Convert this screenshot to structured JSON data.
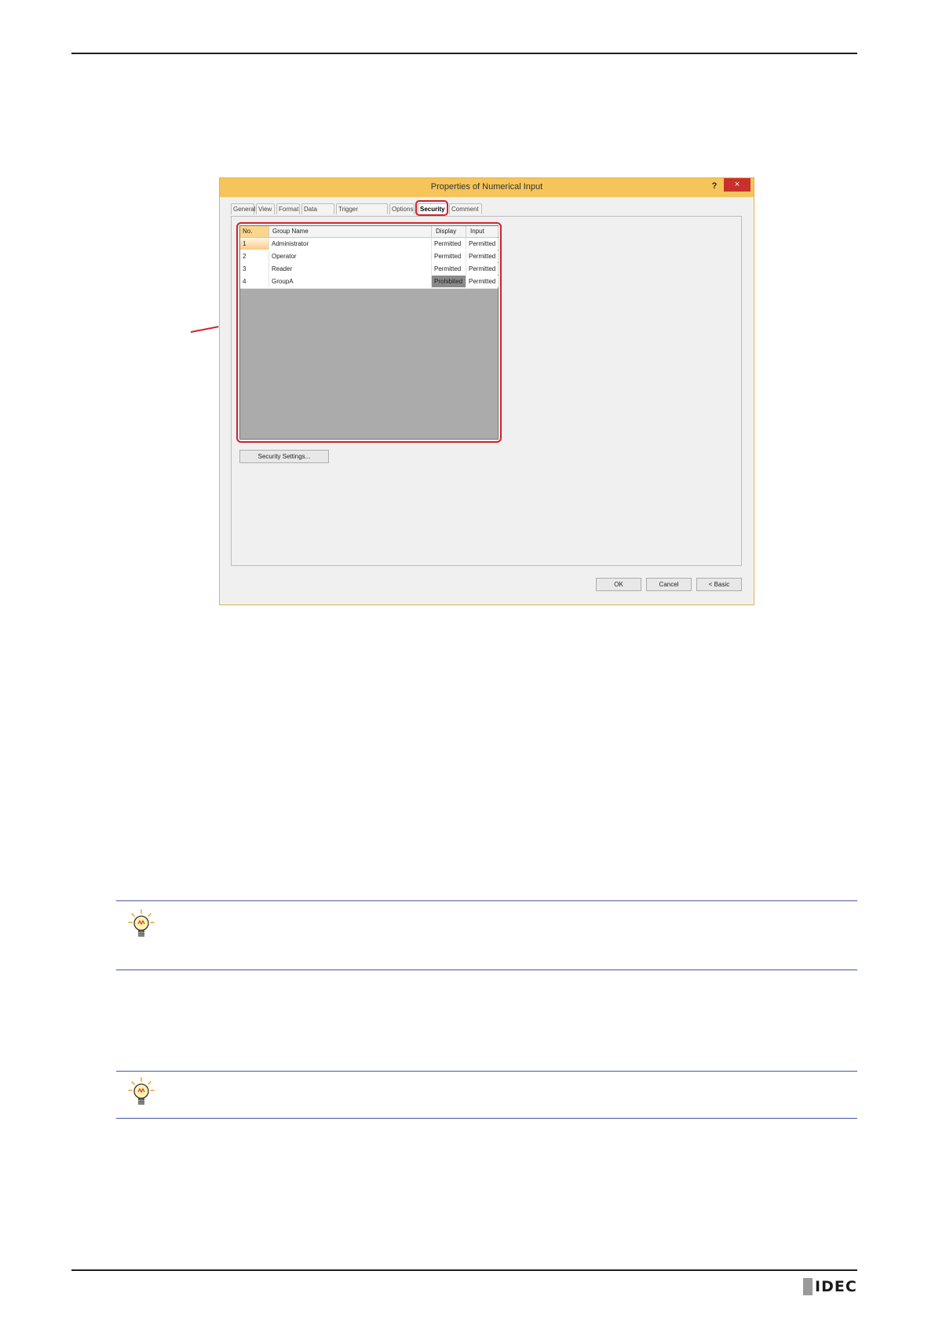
{
  "dialog": {
    "title": "Properties of Numerical Input",
    "help_label": "?",
    "close_label": "×",
    "tabs": [
      {
        "label": "General"
      },
      {
        "label": "View"
      },
      {
        "label": "Format"
      },
      {
        "label": "Data Over"
      },
      {
        "label": "Trigger Condition"
      },
      {
        "label": "Options"
      },
      {
        "label": "Security"
      },
      {
        "label": "Comment"
      }
    ],
    "active_tab": "Security",
    "grid": {
      "columns": [
        "No.",
        "Group Name",
        "Display",
        "Input"
      ],
      "rows": [
        {
          "no": "1",
          "group": "Administrator",
          "display": "Permitted",
          "input": "Permitted"
        },
        {
          "no": "2",
          "group": "Operator",
          "display": "Permitted",
          "input": "Permitted"
        },
        {
          "no": "3",
          "group": "Reader",
          "display": "Permitted",
          "input": "Permitted"
        },
        {
          "no": "4",
          "group": "GroupA",
          "display": "Prohibited",
          "input": "Permitted"
        }
      ]
    },
    "security_settings_label": "Security Settings...",
    "ok_label": "OK",
    "cancel_label": "Cancel",
    "basic_label": "< Basic"
  },
  "logo": {
    "text": "IDEC"
  },
  "colors": {
    "highlight": "#d2232a",
    "title_bar": "#f5c55a",
    "tip_rule": "#4a55a8"
  }
}
